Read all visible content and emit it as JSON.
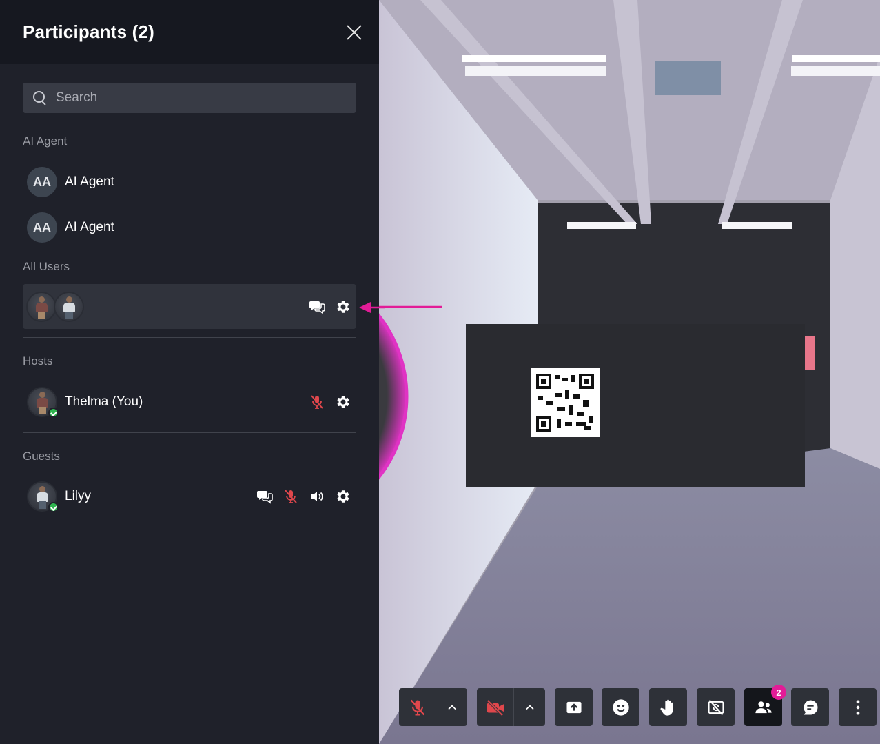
{
  "panel": {
    "title": "Participants (2)",
    "search_placeholder": "Search"
  },
  "sections": {
    "ai_agent": "AI Agent",
    "all_users": "All Users",
    "hosts": "Hosts",
    "guests": "Guests"
  },
  "ai_agents": [
    {
      "initials": "AA",
      "name": "AI Agent"
    },
    {
      "initials": "AA",
      "name": "AI Agent"
    }
  ],
  "hosts": [
    {
      "name": "Thelma (You)",
      "mic_muted": true
    }
  ],
  "guests": [
    {
      "name": "Lilyy",
      "mic_muted": true
    }
  ],
  "toolbar": {
    "participants_badge": "2",
    "buttons": [
      "mic-muted-icon",
      "camera-off-icon",
      "share-screen-icon",
      "emoji-icon",
      "raise-hand-icon",
      "hide-video-icon",
      "participants-icon",
      "chat-icon",
      "more-icon"
    ]
  },
  "colors": {
    "accent_pink": "#e21c97",
    "muted_red": "#e0474c",
    "online_green": "#2fb44f"
  }
}
